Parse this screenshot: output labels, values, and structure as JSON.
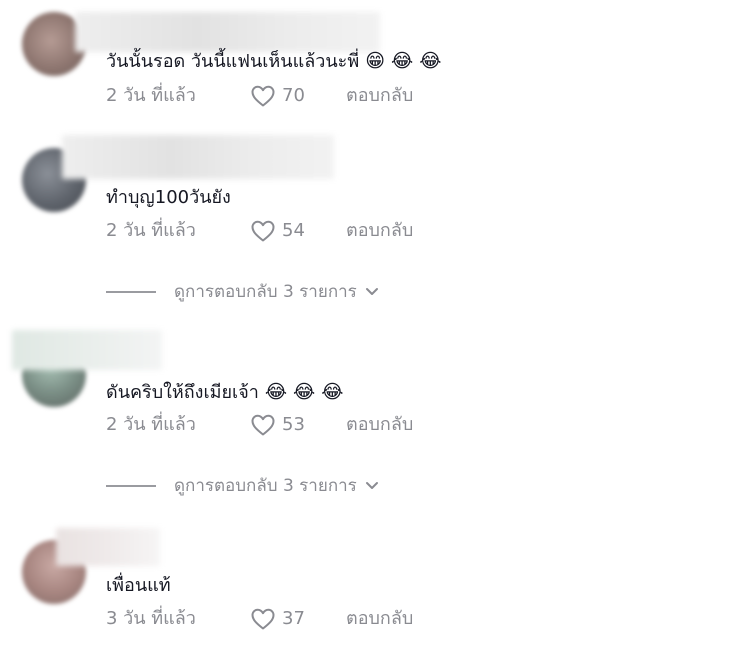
{
  "comments": [
    {
      "text": "วันนั้นรอด วันนี้แฟนเห็นแล้วนะพี่",
      "emojis": [
        "😁",
        "😂",
        "😂"
      ],
      "time": "2 วัน ที่แล้ว",
      "likes": "70",
      "reply": "ตอบกลับ"
    },
    {
      "text": "ทำบุญ100วันยัง",
      "emojis": [],
      "time": "2 วัน ที่แล้ว",
      "likes": "54",
      "reply": "ตอบกลับ",
      "view_replies": "ดูการตอบกลับ 3 รายการ"
    },
    {
      "text": "ดันคริบให้ถึงเมียเจ้า",
      "emojis": [
        "😂",
        "😂",
        "😂"
      ],
      "time": "2 วัน ที่แล้ว",
      "likes": "53",
      "reply": "ตอบกลับ",
      "view_replies": "ดูการตอบกลับ 3 รายการ"
    },
    {
      "text": "เพื่อนแท้",
      "emojis": [],
      "time": "3 วัน ที่แล้ว",
      "likes": "37",
      "reply": "ตอบกลับ"
    }
  ],
  "icons": {
    "like": "heart-outline-icon",
    "expand": "chevron-down-icon"
  },
  "colors": {
    "text": "#161823",
    "meta": "#8a8b91"
  }
}
